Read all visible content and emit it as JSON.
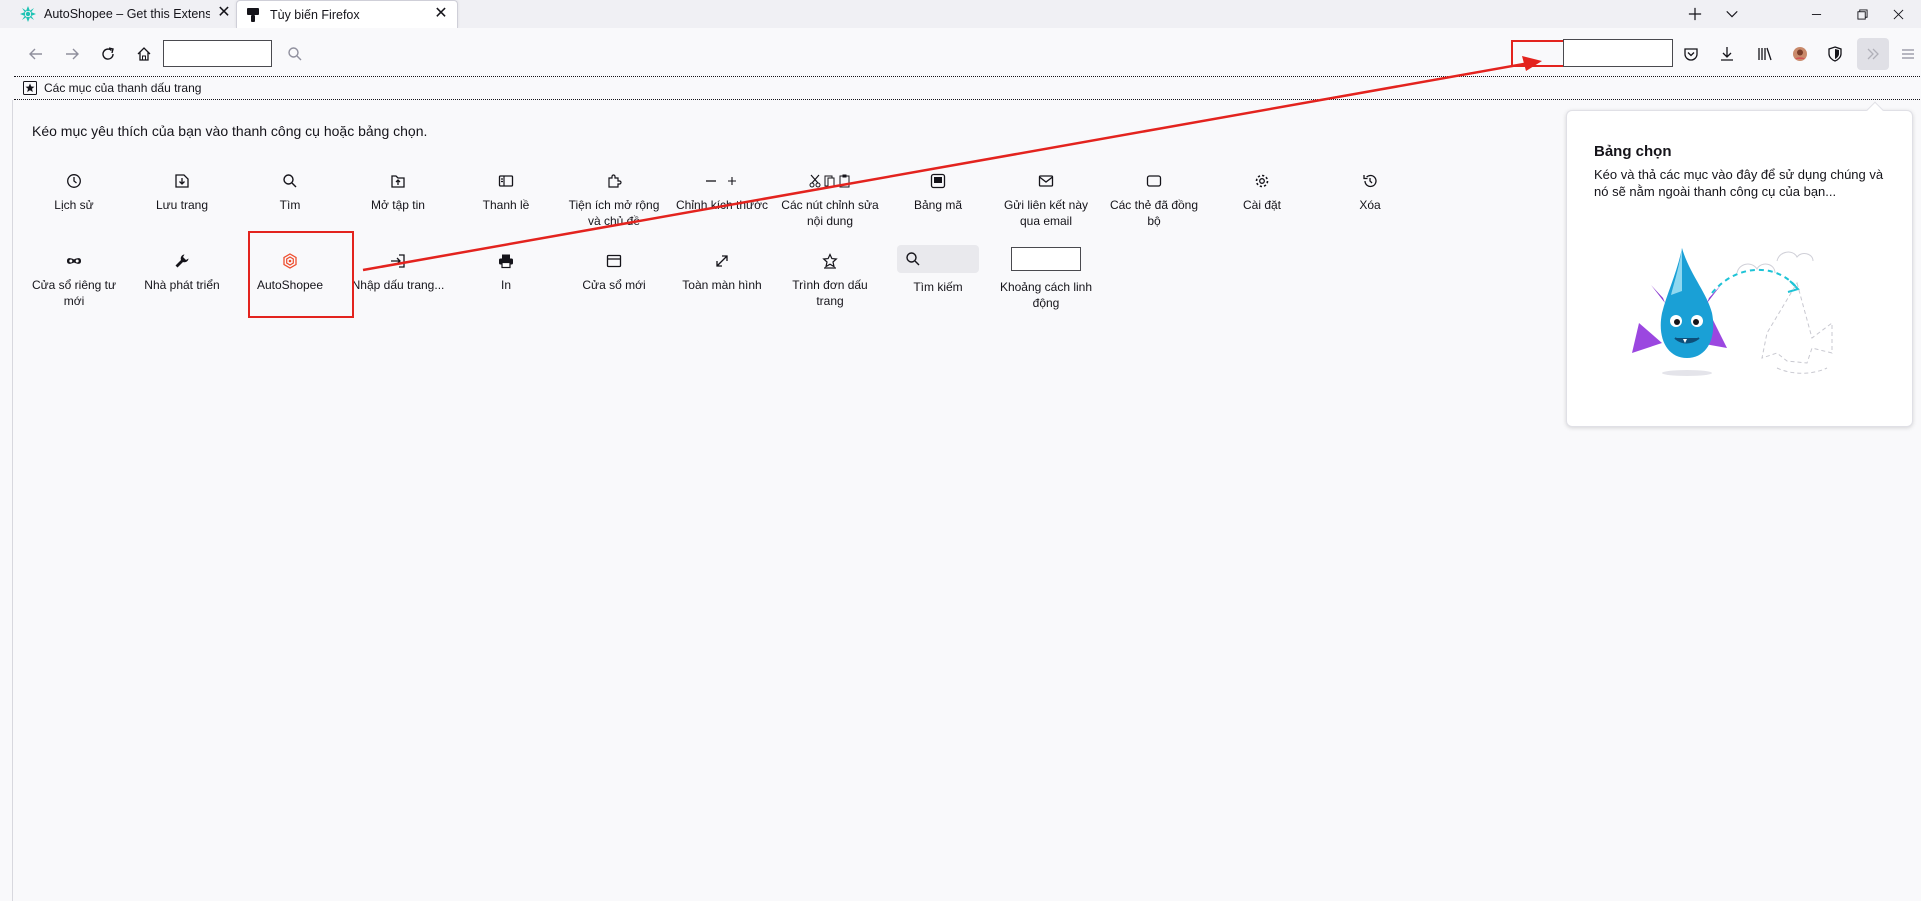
{
  "tabs": [
    {
      "label": "AutoShopee – Get this Extension",
      "close": "✕"
    },
    {
      "label": "Tùy biến Firefox",
      "close": "✕"
    }
  ],
  "bookmarks_bar": {
    "label": "Các mục của thanh dấu trang"
  },
  "customize": {
    "instructions": "Kéo mục yêu thích của bạn vào thanh công cụ hoặc bảng chọn.",
    "palette": [
      {
        "label": "Lịch sử",
        "icon": "clock-icon"
      },
      {
        "label": "Lưu trang",
        "icon": "save-page-icon"
      },
      {
        "label": "Tìm",
        "icon": "search-icon"
      },
      {
        "label": "Mở tập tin",
        "icon": "open-file-icon"
      },
      {
        "label": "Thanh lề",
        "icon": "sidebar-icon"
      },
      {
        "label": "Tiện ích mở rộng và chủ đề",
        "icon": "puzzle-icon"
      },
      {
        "label": "Chỉnh kích thước",
        "icon": "zoom-controls-icon"
      },
      {
        "label": "Các nút chỉnh sửa nội dung",
        "icon": "edit-controls-icon"
      },
      {
        "label": "Bảng mã",
        "icon": "text-encoding-icon"
      },
      {
        "label": "Gửi liên kết này qua email",
        "icon": "email-icon"
      },
      {
        "label": "Các thẻ đã đồng bộ",
        "icon": "synced-tabs-icon"
      },
      {
        "label": "Cài đặt",
        "icon": "gear-icon"
      },
      {
        "label": "Xóa",
        "icon": "forget-icon"
      },
      {
        "label": "Cửa sổ riêng tư mới",
        "icon": "private-mask-icon"
      },
      {
        "label": "Nhà phát triển",
        "icon": "wrench-icon"
      },
      {
        "label": "AutoShopee",
        "icon": "autoshopee-icon"
      },
      {
        "label": "Nhập dấu trang...",
        "icon": "import-icon"
      },
      {
        "label": "In",
        "icon": "printer-icon"
      },
      {
        "label": "Cửa sổ mới",
        "icon": "new-window-icon"
      },
      {
        "label": "Toàn màn hình",
        "icon": "fullscreen-icon"
      },
      {
        "label": "Trình đơn dấu trang",
        "icon": "bookmark-menu-icon"
      },
      {
        "label": "Tìm kiếm",
        "icon": "search-icon"
      },
      {
        "label": "Khoảng cách linh động",
        "icon": "flexible-space"
      }
    ]
  },
  "overflow_panel": {
    "title": "Bảng chọn",
    "description": "Kéo và thả các mục vào đây để sử dụng chúng và nó sẽ nằm ngoài thanh công cụ của bạn..."
  },
  "colors": {
    "annotation_red": "#e3231e",
    "autoshopee_orange": "#ee4d2d",
    "tab_favicon_teal": "#1ec3b4",
    "dragon_blue": "#1aa0d6",
    "dragon_purple": "#9b47e0"
  }
}
